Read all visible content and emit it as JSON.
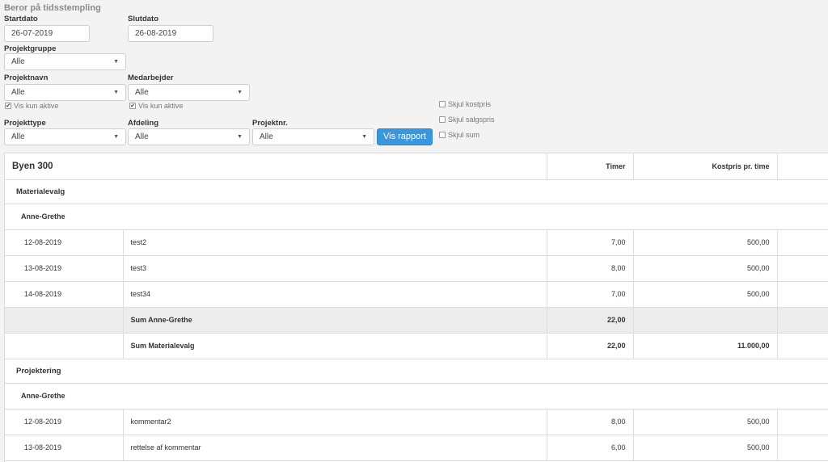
{
  "filters": {
    "note": "Beror på tidsstempling",
    "start_label": "Startdato",
    "start_value": "26-07-2019",
    "end_label": "Slutdato",
    "end_value": "26-08-2019",
    "projektgruppe_label": "Projektgruppe",
    "projektgruppe_value": "Alle",
    "projektnavn_label": "Projektnavn",
    "projektnavn_value": "Alle",
    "medarbejder_label": "Medarbejder",
    "medarbejder_value": "Alle",
    "vis_kun_aktive_1": "Vis kun aktive",
    "vis_kun_aktive_2": "Vis kun aktive",
    "projekttype_label": "Projekttype",
    "projekttype_value": "Alle",
    "afdeling_label": "Afdeling",
    "afdeling_value": "Alle",
    "projektnr_label": "Projektnr.",
    "projektnr_value": "Alle",
    "vis_rapport": "Vis rapport",
    "skjul_kostpris": "Skjul kostpris",
    "skjul_salgspris": "Skjul salgspris",
    "skjul_sum": "Skjul sum"
  },
  "table": {
    "title": "Byen 300",
    "col_timer": "Timer",
    "col_kostpris": "Kostpris pr. time",
    "groups": [
      {
        "name": "Materialevalg",
        "employee": "Anne-Grethe",
        "rows": [
          {
            "date": "12-08-2019",
            "desc": "test2",
            "timer": "7,00",
            "kostpris": "500,00"
          },
          {
            "date": "13-08-2019",
            "desc": "test3",
            "timer": "8,00",
            "kostpris": "500,00"
          },
          {
            "date": "14-08-2019",
            "desc": "test34",
            "timer": "7,00",
            "kostpris": "500,00"
          }
        ],
        "sum_employee_label": "Sum Anne-Grethe",
        "sum_employee_timer": "22,00",
        "sum_group_label": "Sum Materialevalg",
        "sum_group_timer": "22,00",
        "sum_group_kostpris": "11.000,00"
      },
      {
        "name": "Projektering",
        "employee": "Anne-Grethe",
        "rows": [
          {
            "date": "12-08-2019",
            "desc": "kommentar2",
            "timer": "8,00",
            "kostpris": "500,00"
          },
          {
            "date": "13-08-2019",
            "desc": "rettelse af kommentar",
            "timer": "6,00",
            "kostpris": "500,00"
          }
        ]
      }
    ]
  }
}
